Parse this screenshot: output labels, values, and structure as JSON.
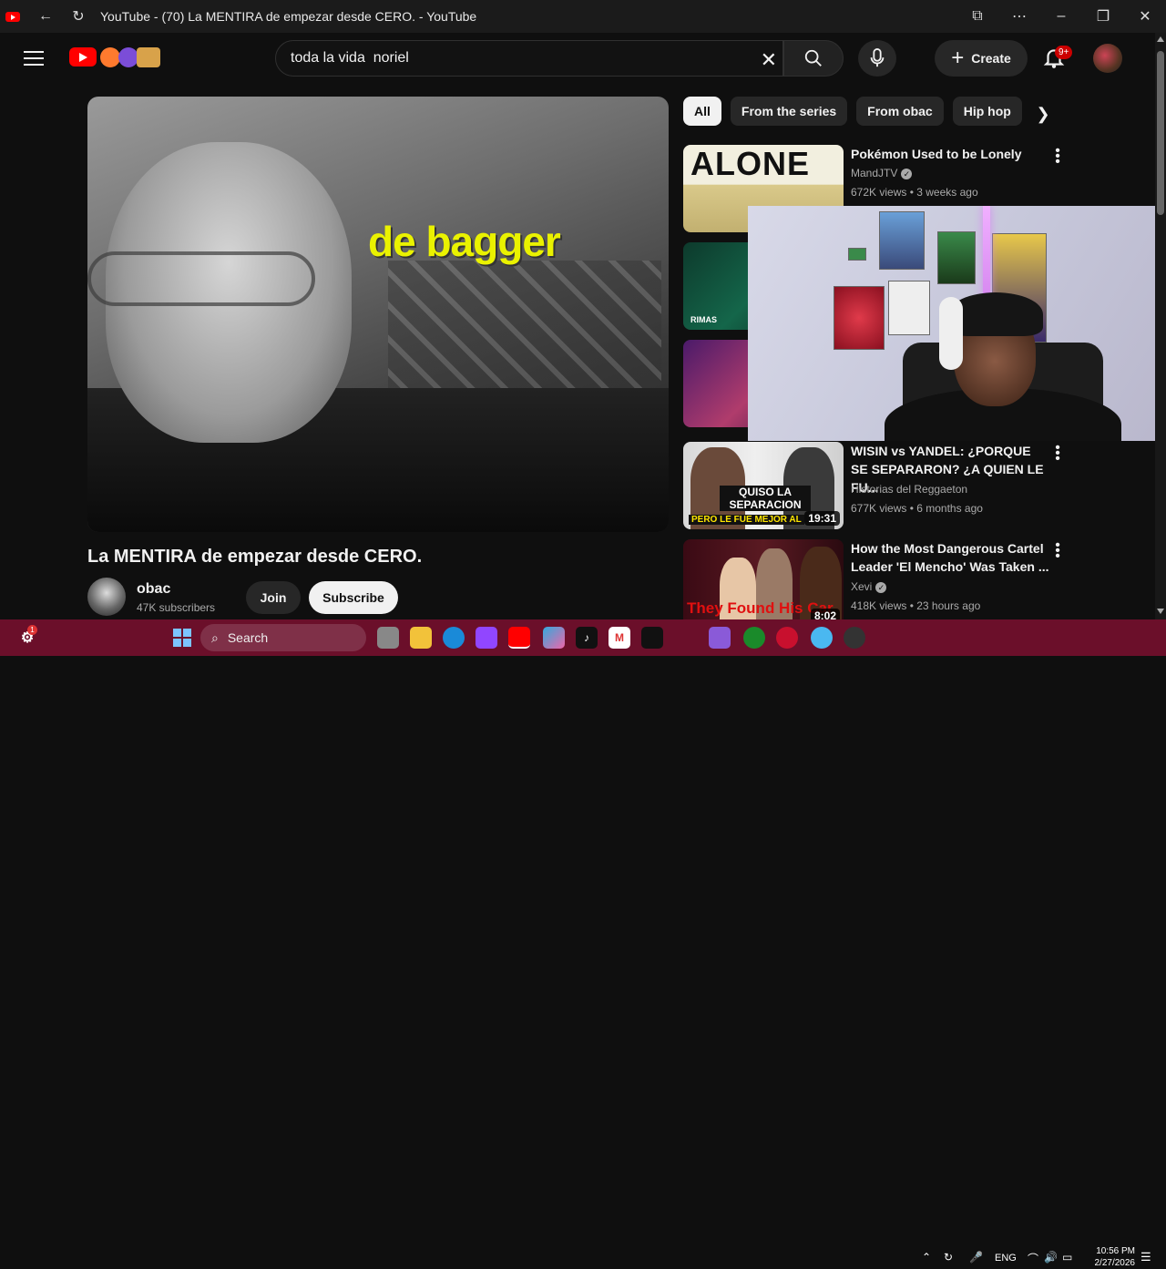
{
  "window": {
    "title": "YouTube - (70) La MENTIRA de empezar desde CERO. - YouTube"
  },
  "header": {
    "search_value": "toda la vida  noriel",
    "create_label": "Create",
    "notifications_badge": "9+"
  },
  "video": {
    "caption": "de bagger",
    "title": "La MENTIRA de empezar desde CERO.",
    "channel": "obac",
    "subscribers": "47K subscribers",
    "join_label": "Join",
    "subscribe_label": "Subscribe"
  },
  "chips": [
    "All",
    "From the series",
    "From obac",
    "Hip hop"
  ],
  "recommendations": [
    {
      "thumb_text": "ALONE",
      "title": "Pokémon Used to be Lonely",
      "channel": "MandJTV",
      "meta": "672K views • 3 weeks ago"
    },
    {
      "thumb_text": "RIMAS"
    },
    {
      "thumb_text": ""
    },
    {
      "thumb_text": "QUISO LA SEPARACION",
      "thumb_text2": "PERO LE FUE MEJOR AL",
      "duration": "19:31",
      "title": "WISIN vs YANDEL: ¿PORQUE SE SEPARARON? ¿A QUIEN LE FU...",
      "channel": "Historias del Reggaeton",
      "meta": "677K views • 6 months ago"
    },
    {
      "thumb_text": "They Found His Car",
      "duration": "8:02",
      "title": "How the Most Dangerous Cartel Leader 'El Mencho' Was Taken ...",
      "channel": "Xevi",
      "meta": "418K views • 23 hours ago"
    }
  ],
  "taskbar": {
    "search_label": "Search",
    "notification_count": "1",
    "language": "ENG",
    "time": "10:56 PM",
    "date": "2/27/2026"
  },
  "colors": {
    "youtube_red": "#ff0000",
    "taskbar": "#6b0f2a",
    "caption_yellow": "#eaf200"
  }
}
